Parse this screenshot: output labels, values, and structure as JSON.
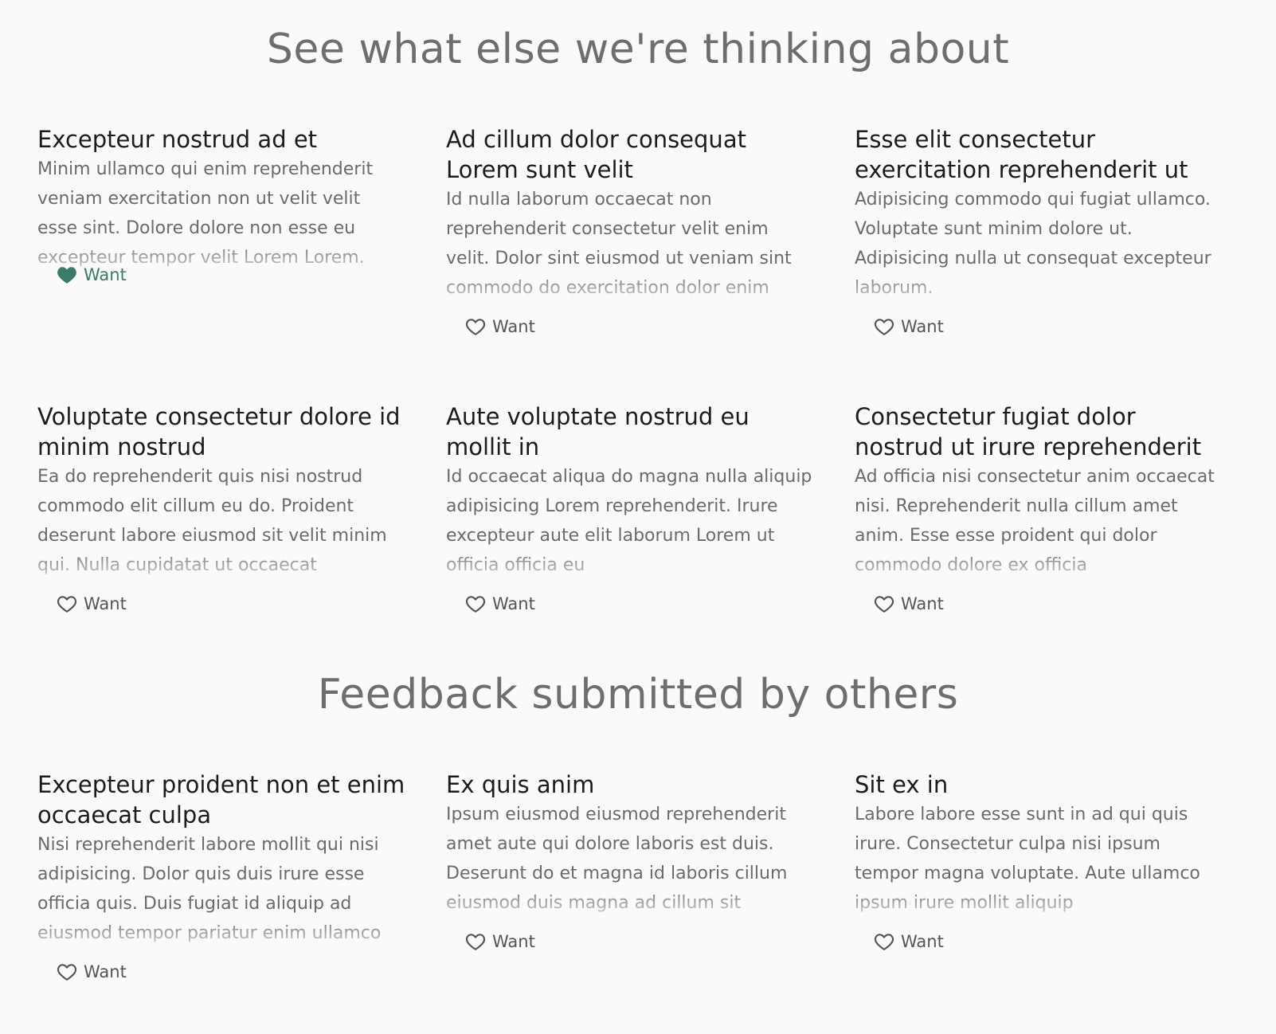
{
  "sections": [
    {
      "title": "See what else we're thinking about",
      "cards": [
        {
          "title": "Excepteur nostrud ad et",
          "description": "Minim ullamco qui enim reprehenderit veniam exercitation non ut velit velit esse sint. Dolore dolore non esse eu excepteur tempor velit Lorem Lorem.",
          "want_label": "Want",
          "wanted": true
        },
        {
          "title": "Ad cillum dolor consequat Lorem sunt velit",
          "description": "Id nulla laborum occaecat non reprehenderit consectetur velit enim velit. Dolor sint eiusmod ut veniam sint commodo do exercitation dolor enim",
          "want_label": "Want",
          "wanted": false
        },
        {
          "title": "Esse elit consectetur exercitation reprehenderit ut",
          "description": "Adipisicing commodo qui fugiat ullamco. Voluptate sunt minim dolore ut. Adipisicing nulla ut consequat excepteur laborum.",
          "want_label": "Want",
          "wanted": false
        },
        {
          "title": "Voluptate consectetur dolore id minim nostrud",
          "description": "Ea do reprehenderit quis nisi nostrud commodo elit cillum eu do. Proident deserunt labore eiusmod sit velit minim qui. Nulla cupidatat ut occaecat",
          "want_label": "Want",
          "wanted": false
        },
        {
          "title": "Aute voluptate nostrud eu mollit in",
          "description": "Id occaecat aliqua do magna nulla aliquip adipisicing Lorem reprehenderit. Irure excepteur aute elit laborum Lorem ut officia officia eu",
          "want_label": "Want",
          "wanted": false
        },
        {
          "title": "Consectetur fugiat dolor nostrud ut irure reprehenderit",
          "description": "Ad officia nisi consectetur anim occaecat nisi. Reprehenderit nulla cillum amet anim. Esse esse proident qui dolor commodo dolore ex officia",
          "want_label": "Want",
          "wanted": false
        }
      ]
    },
    {
      "title": "Feedback submitted by others",
      "cards": [
        {
          "title": "Excepteur proident non et enim occaecat culpa",
          "description": "Nisi reprehenderit labore mollit qui nisi adipisicing. Dolor quis duis irure esse officia quis. Duis fugiat id aliquip ad eiusmod tempor pariatur enim ullamco",
          "want_label": "Want",
          "wanted": false
        },
        {
          "title": "Ex quis anim",
          "description": "Ipsum eiusmod eiusmod reprehenderit amet aute qui dolore laboris est duis. Deserunt do et magna id laboris cillum eiusmod duis magna ad cillum sit",
          "want_label": "Want",
          "wanted": false
        },
        {
          "title": "Sit ex in",
          "description": "Labore labore esse sunt in ad qui quis irure. Consectetur culpa nisi ipsum tempor magna voluptate. Aute ullamco ipsum irure mollit aliquip",
          "want_label": "Want",
          "wanted": false
        }
      ]
    }
  ],
  "colors": {
    "background": "#fafafa",
    "heading": "#6e6e6e",
    "accent": "#3a7c69",
    "icon_default": "#555555"
  },
  "icons": {
    "want_active": "heart-filled-icon",
    "want_inactive": "heart-outline-icon"
  }
}
